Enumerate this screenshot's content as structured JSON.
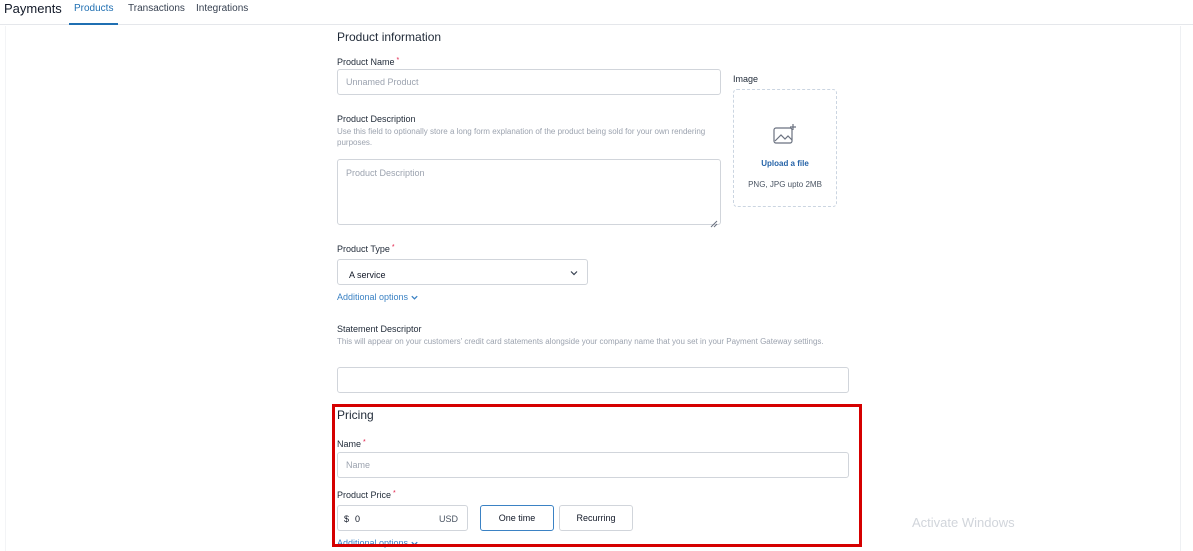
{
  "app": {
    "title": "Payments"
  },
  "tabs": [
    {
      "label": "Products",
      "active": true
    },
    {
      "label": "Transactions",
      "active": false
    },
    {
      "label": "Integrations",
      "active": false
    }
  ],
  "product_info": {
    "section_title": "Product information",
    "name": {
      "label": "Product Name",
      "required_mark": "*",
      "placeholder": "Unnamed Product",
      "value": ""
    },
    "image": {
      "label": "Image",
      "upload_link": "Upload a file",
      "hint": "PNG, JPG upto 2MB",
      "icon": "image-add-icon"
    },
    "description": {
      "label": "Product Description",
      "help": "Use this field to optionally store a long form explanation of the product being sold for your own rendering purposes.",
      "placeholder": "Product Description",
      "value": ""
    },
    "type": {
      "label": "Product Type",
      "required_mark": "*",
      "value": "A service"
    },
    "additional_options": "Additional options",
    "statement_descriptor": {
      "label": "Statement Descriptor",
      "help": "This will appear on your customers' credit card statements alongside your company name that you set in your Payment Gateway settings.",
      "value": ""
    }
  },
  "pricing": {
    "section_title": "Pricing",
    "name": {
      "label": "Name",
      "required_mark": "*",
      "placeholder": "Name",
      "value": ""
    },
    "price": {
      "label": "Product Price",
      "required_mark": "*",
      "currency_symbol": "$",
      "amount": "0",
      "currency_code": "USD"
    },
    "billing": {
      "one_time": "One time",
      "recurring": "Recurring",
      "selected": "One time"
    },
    "additional_options": "Additional options"
  },
  "watermark": "Activate Windows",
  "colors": {
    "accent": "#1f6fb2",
    "link": "#3b82c4",
    "required": "#e11d48",
    "highlight": "#d50000"
  }
}
